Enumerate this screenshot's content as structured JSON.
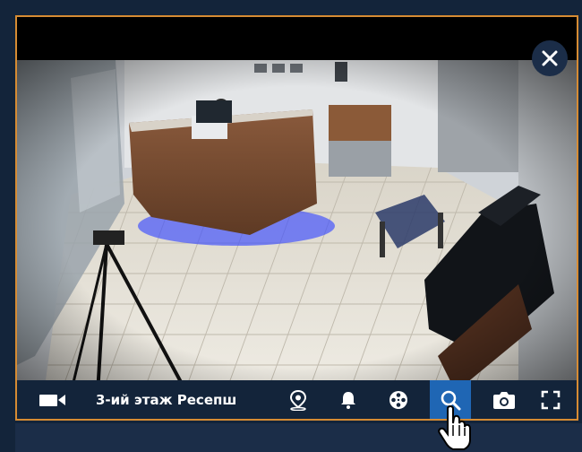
{
  "camera": {
    "title": "3-ий этаж Ресепш"
  },
  "icons": {
    "close": "close-icon",
    "camera": "video-camera-icon",
    "location": "map-pin-icon",
    "bell": "bell-icon",
    "film": "film-reel-icon",
    "zoom": "search-icon",
    "snapshot": "camera-snapshot-icon",
    "fullscreen": "fullscreen-icon",
    "pointer": "hand-pointer-cursor-icon"
  },
  "colors": {
    "background": "#13243a",
    "tile_border": "#d68b33",
    "active_button": "#1f66b4",
    "close_button": "#1b2d48"
  }
}
